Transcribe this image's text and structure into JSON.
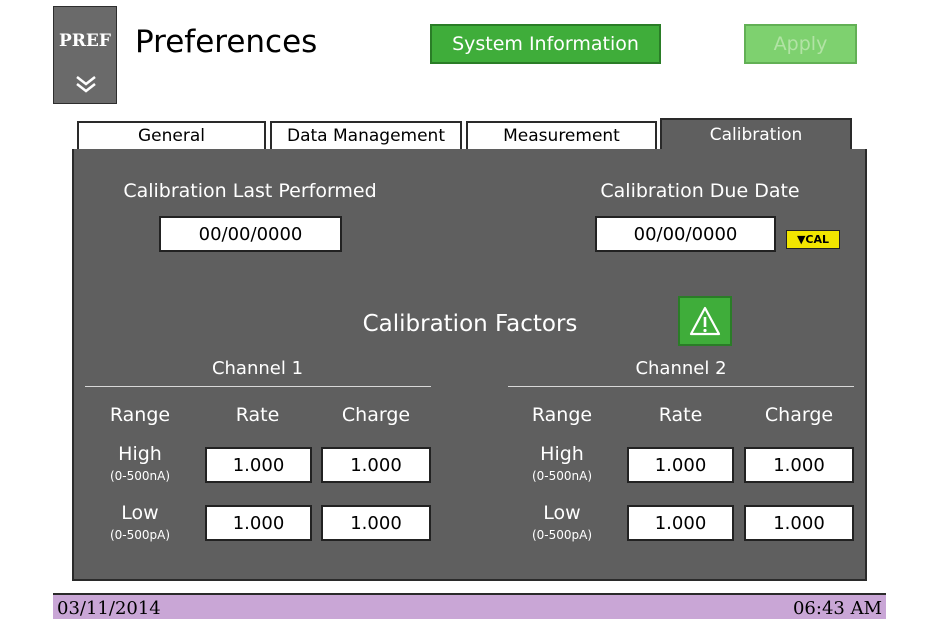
{
  "header": {
    "pref_button": "PREF",
    "title": "Preferences",
    "system_info_button": "System Information",
    "apply_button": "Apply"
  },
  "tabs": [
    {
      "label": "General"
    },
    {
      "label": "Data Management"
    },
    {
      "label": "Measurement"
    },
    {
      "label": "Calibration",
      "active": true
    }
  ],
  "calibration": {
    "last_performed_label": "Calibration Last Performed",
    "last_performed_value": "00/00/0000",
    "due_date_label": "Calibration Due Date",
    "due_date_value": "00/00/0000",
    "cal_badge": "▼CAL",
    "factors_title": "Calibration Factors",
    "channels": [
      {
        "title": "Channel 1",
        "headers": {
          "range": "Range",
          "rate": "Rate",
          "charge": "Charge"
        },
        "rows": [
          {
            "range": "High",
            "sub": "(0-500nA)",
            "rate": "1.000",
            "charge": "1.000"
          },
          {
            "range": "Low",
            "sub": "(0-500pA)",
            "rate": "1.000",
            "charge": "1.000"
          }
        ]
      },
      {
        "title": "Channel 2",
        "headers": {
          "range": "Range",
          "rate": "Rate",
          "charge": "Charge"
        },
        "rows": [
          {
            "range": "High",
            "sub": "(0-500nA)",
            "rate": "1.000",
            "charge": "1.000"
          },
          {
            "range": "Low",
            "sub": "(0-500pA)",
            "rate": "1.000",
            "charge": "1.000"
          }
        ]
      }
    ]
  },
  "status": {
    "date": "03/11/2014",
    "time": "06:43 AM"
  },
  "colors": {
    "panel": "#5f5f5f",
    "button_green": "#3fad3a",
    "apply_disabled": "#7ed16f",
    "cal_badge": "#f2e600",
    "statusbar": "#c9a6d6"
  },
  "icons": {
    "pref_chevron": "double-chevron-down-icon",
    "warning": "warning-triangle-icon"
  }
}
